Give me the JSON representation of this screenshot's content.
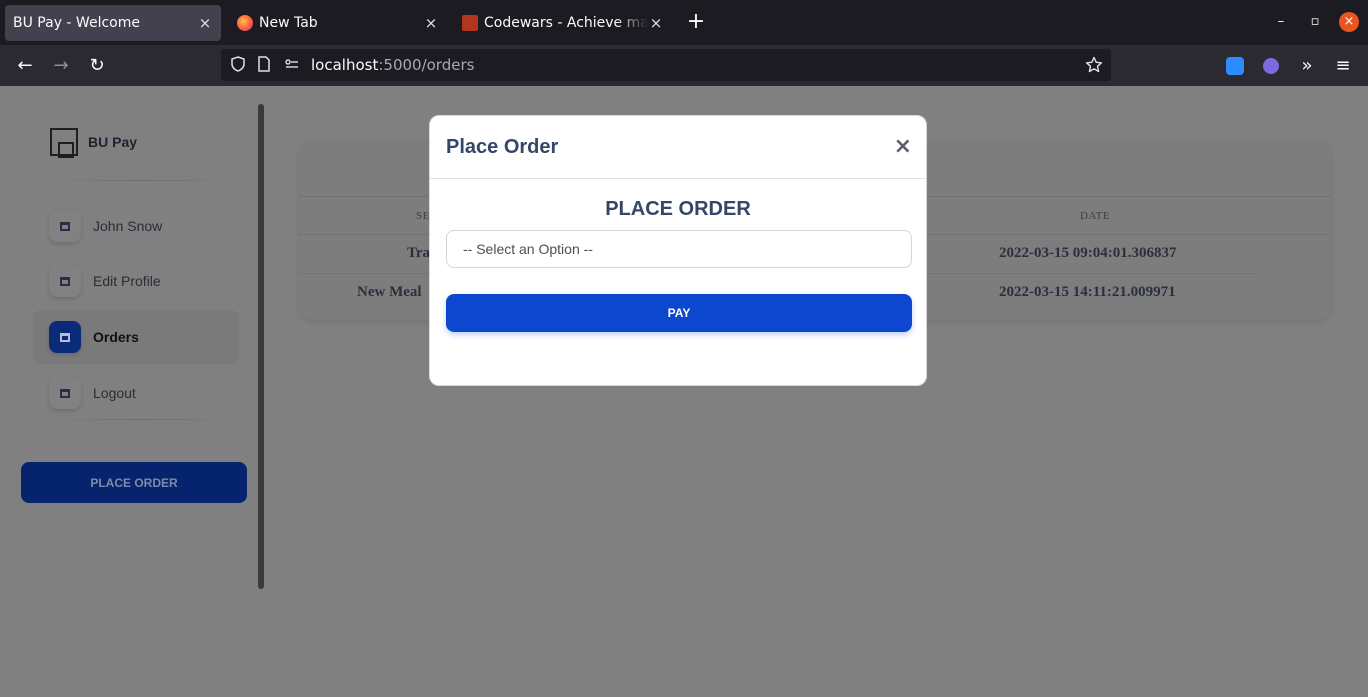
{
  "browser": {
    "tabs": [
      {
        "title": "BU Pay - Welcome",
        "close": "×"
      },
      {
        "title": "New Tab",
        "close": "×"
      },
      {
        "title": "Codewars - Achieve mastery",
        "close": "×"
      }
    ],
    "new_tab": "+",
    "url_host": "localhost",
    "url_path": ":5000/orders",
    "window_controls": {
      "minimize": "–",
      "maximize": "▫",
      "close": "×"
    },
    "nav": {
      "back": "←",
      "forward": "→",
      "reload": "↻",
      "overflow": "»",
      "menu": "≡"
    },
    "icons": {
      "shield": "shield-icon",
      "page": "page-icon",
      "permissions": "permissions-icon",
      "star": "star-icon"
    }
  },
  "sidebar": {
    "brand": "BU Pay",
    "items": [
      {
        "label": "John Snow",
        "active": false
      },
      {
        "label": "Edit Profile",
        "active": false
      },
      {
        "label": "Orders",
        "active": true
      },
      {
        "label": "Logout",
        "active": false
      }
    ],
    "place_order_label": "PLACE ORDER"
  },
  "orders_table": {
    "headers": {
      "service": "SE",
      "date": "DATE"
    },
    "rows": [
      {
        "service": "Tra",
        "date": "2022-03-15 09:04:01.306837"
      },
      {
        "service": "New Meal",
        "date": "2022-03-15 14:11:21.009971"
      }
    ]
  },
  "modal": {
    "title": "Place Order",
    "close": "×",
    "heading": "PLACE ORDER",
    "select_value": "-- Select an Option --",
    "pay_label": "PAY"
  },
  "colors": {
    "accent": "#0d47d0",
    "sidebar_button": "#06236e",
    "title_text": "#344767",
    "backdrop": "#808080"
  }
}
